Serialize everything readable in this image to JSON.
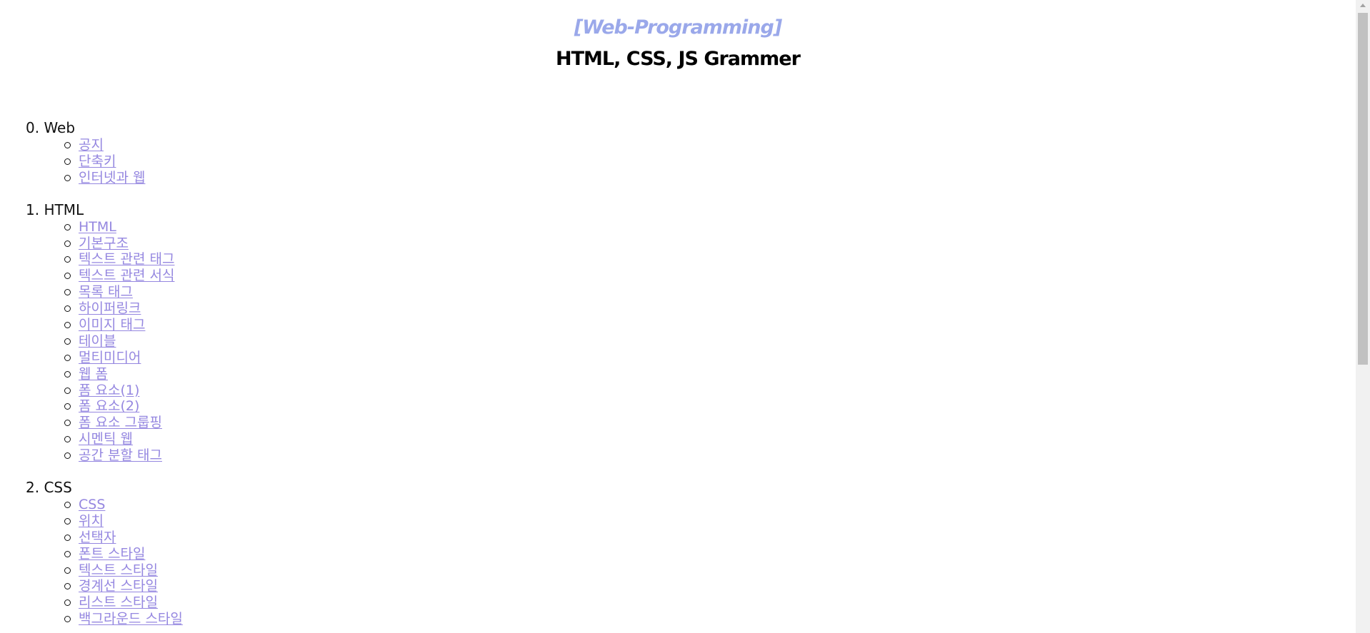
{
  "header": {
    "subtitle": "[Web-Programming]",
    "title": "HTML, CSS, JS Grammer"
  },
  "sections": [
    {
      "title": "0. Web",
      "items": [
        "공지",
        "단축키",
        "인터넷과 웹"
      ]
    },
    {
      "title": "1. HTML",
      "items": [
        "HTML",
        "기본구조",
        "텍스트 관련 태그",
        "텍스트 관련 서식",
        "목록 태그",
        "하이퍼링크",
        "이미지 태그",
        "테이블",
        "멀티미디어",
        "웹 폼",
        "폼 요소(1)",
        "폼 요소(2)",
        "폼 요소 그룹핑",
        "시멘틱 웹",
        "공간 분할 태그"
      ]
    },
    {
      "title": "2. CSS",
      "items": [
        "CSS",
        "위치",
        "선택자",
        "폰트 스타일",
        "텍스트 스타일",
        "경계선 스타일",
        "리스트 스타일",
        "백그라운드 스타일"
      ]
    }
  ],
  "colors": {
    "subtitle": "#9aa8ea",
    "link": "#9587e0",
    "text": "#111111"
  },
  "icons": {
    "bullet": "circle-outline-bullet-icon",
    "scroll_up": "chevron-up-icon"
  }
}
